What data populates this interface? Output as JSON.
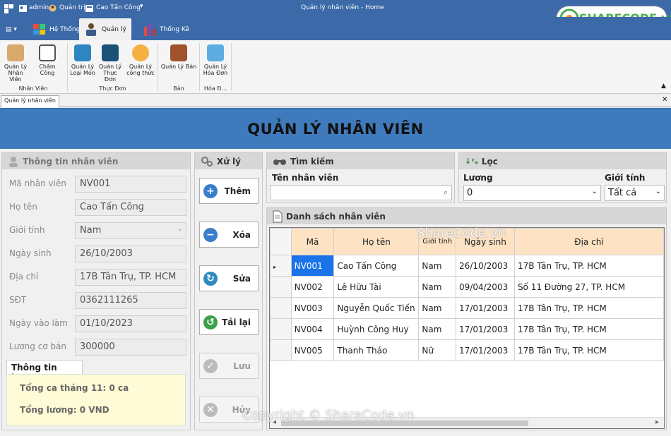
{
  "titlebar": {
    "user": "admin",
    "role": "Quản trị",
    "name": "Cao Tấn Công",
    "title": "Quản lý nhân viên - Home"
  },
  "tabs": [
    "Hệ Thống",
    "Quản lý",
    "Thống Kê"
  ],
  "ribbon": {
    "buttons": [
      "Quản Lý Nhân Viên",
      "Chấm Công",
      "Quản Lý Loại Món",
      "Quản Lý Thực Đơn",
      "Quản Lý công thức",
      "Quản Lý Bàn",
      "Quản Lý Hóa Đơn"
    ],
    "groups": [
      "Nhân Viên",
      "Thực Đơn",
      "Bàn",
      "Hóa Đ..."
    ]
  },
  "watermark_logo": "SHARECODE.vn",
  "doc_tab": "Quản lý nhân viên",
  "header": "QUẢN LÝ NHÂN VIÊN",
  "info": {
    "title": "Thông tin nhân viên",
    "labels": [
      "Mã nhân viên",
      "Họ tên",
      "Giới tính",
      "Ngày sinh",
      "Địa chỉ",
      "SĐT",
      "Ngày vào làm",
      "Lương cơ bản"
    ],
    "values": [
      "NV001",
      "Cao Tấn Công",
      "Nam",
      "26/10/2003",
      "17B Tân Trụ, TP. HCM",
      "0362111265",
      "01/10/2023",
      "300000"
    ],
    "salary_tab": "Thông tin lương",
    "shifts": "Tổng ca tháng 11: 0 ca",
    "total": "Tổng lương: 0 VND"
  },
  "actions": {
    "title": "Xử lý",
    "buttons": [
      "Thêm",
      "Xóa",
      "Sửa",
      "Tải lại",
      "Lưu",
      "Hủy"
    ]
  },
  "search": {
    "title": "Tìm kiếm",
    "label": "Tên nhân viên",
    "value": ""
  },
  "filter": {
    "title": "Lọc",
    "salary_label": "Lương",
    "salary_value": "0",
    "gender_label": "Giới tính",
    "gender_value": "Tất cả"
  },
  "list": {
    "title": "Danh sách nhân viên",
    "columns": [
      "Mã",
      "Họ tên",
      "Giới tính",
      "Ngày sinh",
      "Địa chỉ"
    ],
    "rows": [
      [
        "NV001",
        "Cao Tấn Công",
        "Nam",
        "26/10/2003",
        "17B Tân Trụ, TP. HCM"
      ],
      [
        "NV002",
        "Lê Hữu Tài",
        "Nam",
        "09/04/2003",
        "Số 11 Đường 27, TP. HCM"
      ],
      [
        "NV003",
        "Nguyễn Quốc Tiến",
        "Nam",
        "17/01/2003",
        "17B Tân Trụ, TP. HCM"
      ],
      [
        "NV004",
        "Huỳnh Công Huy",
        "Nam",
        "17/01/2003",
        "17B Tân Trụ, TP. HCM"
      ],
      [
        "NV005",
        "Thanh Thảo",
        "Nữ",
        "17/01/2003",
        "17B Tân Trụ, TP. HCM"
      ]
    ]
  },
  "watermarks": [
    "ShareCode.vn",
    "Copyright © ShareCode.vn"
  ]
}
